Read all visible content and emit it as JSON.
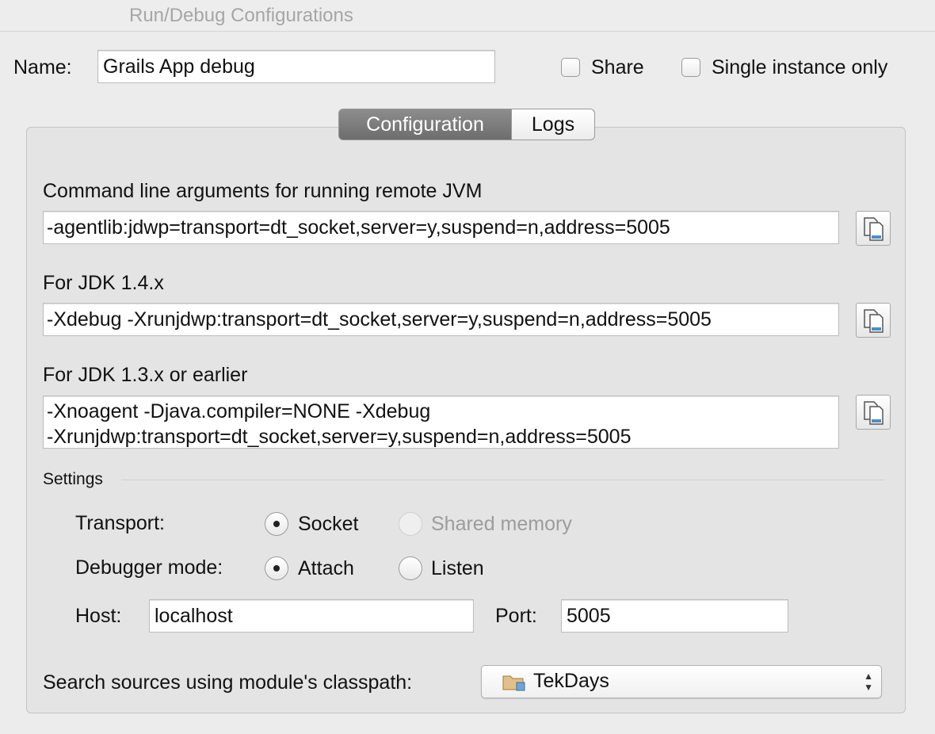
{
  "window": {
    "title": "Run/Debug Configurations"
  },
  "name": {
    "label": "Name:",
    "value": "Grails App debug"
  },
  "options": {
    "share_label": "Share",
    "single_instance_label": "Single instance only"
  },
  "tabs": [
    {
      "label": "Configuration",
      "active": true
    },
    {
      "label": "Logs",
      "active": false
    }
  ],
  "jvm": {
    "cmd_label": "Command line arguments for running remote JVM",
    "cmd_value": "-agentlib:jdwp=transport=dt_socket,server=y,suspend=n,address=5005",
    "jdk14_label": "For JDK 1.4.x",
    "jdk14_value": "-Xdebug -Xrunjdwp:transport=dt_socket,server=y,suspend=n,address=5005",
    "jdk13_label": "For JDK 1.3.x or earlier",
    "jdk13_line1": "-Xnoagent -Djava.compiler=NONE -Xdebug",
    "jdk13_line2": "-Xrunjdwp:transport=dt_socket,server=y,suspend=n,address=5005"
  },
  "settings": {
    "heading": "Settings",
    "transport_label": "Transport:",
    "transport_socket": "Socket",
    "transport_shared": "Shared memory",
    "mode_label": "Debugger mode:",
    "mode_attach": "Attach",
    "mode_listen": "Listen",
    "host_label": "Host:",
    "host_value": "localhost",
    "port_label": "Port:",
    "port_value": "5005"
  },
  "classpath": {
    "label": "Search sources using module's classpath:",
    "module": "TekDays",
    "icon": "folder-icon"
  },
  "colors": {
    "active_tab": "#7d7d7d",
    "panel": "#e4e4e4",
    "window": "#ececec"
  }
}
